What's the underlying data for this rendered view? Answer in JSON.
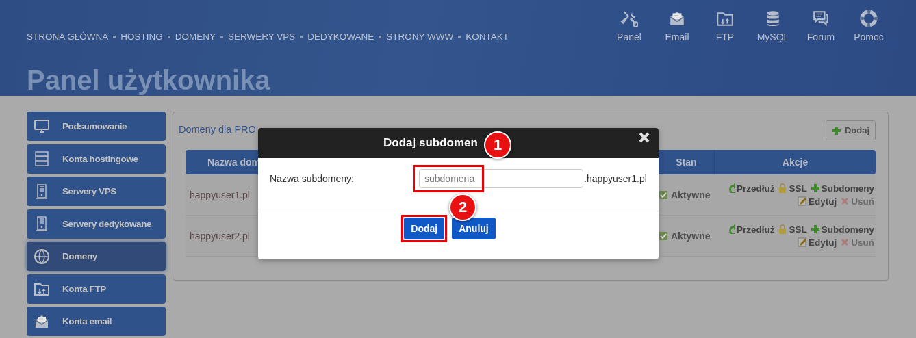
{
  "nav": {
    "links": [
      "STRONA GŁÓWNA",
      "HOSTING",
      "DOMENY",
      "SERWERY VPS",
      "DEDYKOWANE",
      "STRONY WWW",
      "KONTAKT"
    ]
  },
  "quick_links": [
    {
      "label": "Panel",
      "kind": "tools"
    },
    {
      "label": "Email",
      "kind": "mail"
    },
    {
      "label": "FTP",
      "kind": "folder"
    },
    {
      "label": "MySQL",
      "kind": "database"
    },
    {
      "label": "Forum",
      "kind": "chat"
    },
    {
      "label": "Pomoc",
      "kind": "lifebuoy"
    }
  ],
  "page_title": "Panel użytkownika",
  "sidebar": {
    "items": [
      {
        "label": "Podsumowanie",
        "kind": "monitor",
        "selected": false
      },
      {
        "label": "Konta hostingowe",
        "kind": "rack",
        "selected": false
      },
      {
        "label": "Serwery VPS",
        "kind": "tower",
        "selected": false
      },
      {
        "label": "Serwery dedykowane",
        "kind": "tower",
        "selected": false
      },
      {
        "label": "Domeny",
        "kind": "globe",
        "selected": true
      },
      {
        "label": "Konta FTP",
        "kind": "folder",
        "selected": false
      },
      {
        "label": "Konta email",
        "kind": "mail",
        "selected": false
      }
    ]
  },
  "panel": {
    "title": "Domeny dla PRO",
    "add_button": "Dodaj"
  },
  "table": {
    "columns": [
      "Nazwa dom",
      "Stan",
      "Akcje"
    ],
    "rows": [
      {
        "domain": "happyuser1.pl",
        "status": "Aktywne",
        "actions": [
          {
            "label": "Przedłuż",
            "kind": "renew",
            "disabled": false
          },
          {
            "label": "SSL",
            "kind": "lock",
            "disabled": false
          },
          {
            "label": "Subdomeny",
            "kind": "plus",
            "disabled": false
          },
          {
            "label": "Edytuj",
            "kind": "pencil",
            "disabled": false
          },
          {
            "label": "Usuń",
            "kind": "cross",
            "disabled": true
          }
        ]
      },
      {
        "domain": "happyuser2.pl",
        "status": "Aktywne",
        "actions": [
          {
            "label": "Przedłuż",
            "kind": "renew",
            "disabled": false
          },
          {
            "label": "SSL",
            "kind": "lock",
            "disabled": false
          },
          {
            "label": "Subdomeny",
            "kind": "plus",
            "disabled": false
          },
          {
            "label": "Edytuj",
            "kind": "pencil",
            "disabled": false
          },
          {
            "label": "Usuń",
            "kind": "cross",
            "disabled": true
          }
        ]
      }
    ]
  },
  "dialog": {
    "title": "Dodaj subdomen",
    "field_label": "Nazwa subdomeny:",
    "placeholder": "subdomena",
    "field_highlighted": true,
    "suffix": ".happyuser1.pl",
    "buttons": [
      {
        "label": "Dodaj",
        "highlighted": true
      },
      {
        "label": "Anuluj",
        "highlighted": false
      }
    ],
    "annotations": [
      "1",
      "2"
    ]
  }
}
